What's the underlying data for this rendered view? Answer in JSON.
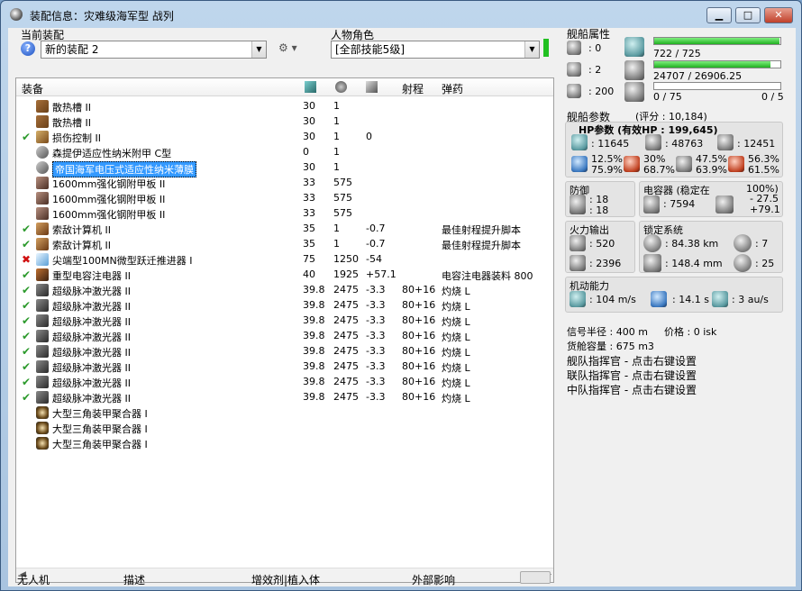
{
  "window": {
    "title": "装配信息：灾难级海军型 战列",
    "btn_minimize": "▁",
    "btn_maximize": "□",
    "btn_close": "✕"
  },
  "fitting": {
    "current_label": "当前装配",
    "current_value": "新的装配 2",
    "character_label": "人物角色",
    "character_value": "[全部技能5级]"
  },
  "columns": {
    "equipment": "装备",
    "range": "射程",
    "ammo": "弹药"
  },
  "rows": [
    {
      "check": "",
      "icon": "heat",
      "name": "散热槽 II",
      "cpu": "30",
      "pg": "1",
      "cap": "",
      "range": "",
      "ammo": ""
    },
    {
      "check": "",
      "icon": "heat",
      "name": "散热槽 II",
      "cpu": "30",
      "pg": "1",
      "cap": "",
      "range": "",
      "ammo": ""
    },
    {
      "check": "✔",
      "icon": "dmg",
      "name": "损伤控制 II",
      "cpu": "30",
      "pg": "1",
      "cap": "0",
      "range": "",
      "ammo": ""
    },
    {
      "check": "",
      "icon": "nano",
      "name": "森提伊适应性纳米附甲 C型",
      "cpu": "0",
      "pg": "1",
      "cap": "",
      "range": "",
      "ammo": ""
    },
    {
      "check": "",
      "icon": "nano",
      "name": "帝国海军电压式适应性纳米薄膜",
      "cpu": "30",
      "pg": "1",
      "cap": "",
      "range": "",
      "ammo": "",
      "selected": true
    },
    {
      "check": "",
      "icon": "plate",
      "name": "1600mm强化钢附甲板 II",
      "cpu": "33",
      "pg": "575",
      "cap": "",
      "range": "",
      "ammo": ""
    },
    {
      "check": "",
      "icon": "plate",
      "name": "1600mm强化钢附甲板 II",
      "cpu": "33",
      "pg": "575",
      "cap": "",
      "range": "",
      "ammo": ""
    },
    {
      "check": "",
      "icon": "plate",
      "name": "1600mm强化钢附甲板 II",
      "cpu": "33",
      "pg": "575",
      "cap": "",
      "range": "",
      "ammo": ""
    },
    {
      "check": "✔",
      "icon": "scan",
      "name": "索敌计算机 II",
      "cpu": "35",
      "pg": "1",
      "cap": "-0.7",
      "range": "",
      "ammo": "最佳射程提升脚本"
    },
    {
      "check": "✔",
      "icon": "scan",
      "name": "索敌计算机 II",
      "cpu": "35",
      "pg": "1",
      "cap": "-0.7",
      "range": "",
      "ammo": "最佳射程提升脚本"
    },
    {
      "check": "✖",
      "icon": "mwd",
      "name": "尖端型100MN微型跃迁推进器 I",
      "cpu": "75",
      "pg": "1250",
      "cap": "-54",
      "range": "",
      "ammo": ""
    },
    {
      "check": "✔",
      "icon": "cap",
      "name": "重型电容注电器 II",
      "cpu": "40",
      "pg": "1925",
      "cap": "+57.1",
      "range": "",
      "ammo": "电容注电器装料 800"
    },
    {
      "check": "✔",
      "icon": "laser",
      "name": "超级脉冲激光器 II",
      "cpu": "39.8",
      "pg": "2475",
      "cap": "-3.3",
      "range": "80+16",
      "ammo": "灼烧 L"
    },
    {
      "check": "✔",
      "icon": "laser",
      "name": "超级脉冲激光器 II",
      "cpu": "39.8",
      "pg": "2475",
      "cap": "-3.3",
      "range": "80+16",
      "ammo": "灼烧 L"
    },
    {
      "check": "✔",
      "icon": "laser",
      "name": "超级脉冲激光器 II",
      "cpu": "39.8",
      "pg": "2475",
      "cap": "-3.3",
      "range": "80+16",
      "ammo": "灼烧 L"
    },
    {
      "check": "✔",
      "icon": "laser",
      "name": "超级脉冲激光器 II",
      "cpu": "39.8",
      "pg": "2475",
      "cap": "-3.3",
      "range": "80+16",
      "ammo": "灼烧 L"
    },
    {
      "check": "✔",
      "icon": "laser",
      "name": "超级脉冲激光器 II",
      "cpu": "39.8",
      "pg": "2475",
      "cap": "-3.3",
      "range": "80+16",
      "ammo": "灼烧 L"
    },
    {
      "check": "✔",
      "icon": "laser",
      "name": "超级脉冲激光器 II",
      "cpu": "39.8",
      "pg": "2475",
      "cap": "-3.3",
      "range": "80+16",
      "ammo": "灼烧 L"
    },
    {
      "check": "✔",
      "icon": "laser",
      "name": "超级脉冲激光器 II",
      "cpu": "39.8",
      "pg": "2475",
      "cap": "-3.3",
      "range": "80+16",
      "ammo": "灼烧 L"
    },
    {
      "check": "✔",
      "icon": "laser",
      "name": "超级脉冲激光器 II",
      "cpu": "39.8",
      "pg": "2475",
      "cap": "-3.3",
      "range": "80+16",
      "ammo": "灼烧 L"
    },
    {
      "check": "",
      "icon": "rig",
      "name": "大型三角装甲聚合器 I",
      "cpu": "",
      "pg": "",
      "cap": "",
      "range": "",
      "ammo": ""
    },
    {
      "check": "",
      "icon": "rig",
      "name": "大型三角装甲聚合器 I",
      "cpu": "",
      "pg": "",
      "cap": "",
      "range": "",
      "ammo": ""
    },
    {
      "check": "",
      "icon": "rig",
      "name": "大型三角装甲聚合器 I",
      "cpu": "",
      "pg": "",
      "cap": "",
      "range": "",
      "ammo": ""
    }
  ],
  "bottom_tabs": [
    "无人机",
    "描述",
    "增效剂|植入体",
    "外部影响"
  ],
  "ship_attr": {
    "title": "舰船属性",
    "turret_slots": ": 0",
    "launcher_slots": ": 2",
    "drone_bay": ": 200",
    "cpu_text": "722 / 725",
    "cpu_fraction": 0.996,
    "pg_text": "24707 / 26906.25",
    "pg_fraction": 0.918,
    "calib_text": "0 / 75",
    "calib_fraction": 0,
    "calib_right": "0 / 5"
  },
  "ship_params": {
    "title": "舰船参数",
    "rating": "(评分 : 10,184)",
    "hp_line": "HP参数 (有效HP : 199,645)",
    "hp_shield": ": 11645",
    "hp_armor": ": 48763",
    "hp_struct": ": 12451",
    "res_em": "12.5%",
    "res_em2": "75.9%",
    "res_th": "30%",
    "res_th2": "68.7%",
    "res_ki": "47.5%",
    "res_ki2": "63.9%",
    "res_ex": "56.3%",
    "res_ex2": "61.5%"
  },
  "defense": {
    "title": "防御",
    "v1": ": 18",
    "v2": ": 18"
  },
  "capacitor": {
    "title": "电容器 (稳定在",
    "pct": "100%)",
    "amount": ": 7594",
    "d1": "- 27.5",
    "d2": "+79.1"
  },
  "firepower": {
    "title": "火力输出",
    "dps": ": 520",
    "volley": ": 2396"
  },
  "targeting": {
    "title": "锁定系统",
    "range": ": 84.38 km",
    "targets": ": 7",
    "scan": ": 148.4 mm",
    "sensor": ": 25"
  },
  "mobility": {
    "title": "机动能力",
    "speed": ": 104 m/s",
    "align": ": 14.1 s",
    "warp": ": 3 au/s"
  },
  "misc": {
    "sig_radius": "信号半径 : 400 m",
    "price": "价格 : 0 isk",
    "cargo": "货舱容量 : 675 m3",
    "fleet1": "舰队指挥官 - 点击右键设置",
    "fleet2": "联队指挥官 - 点击右键设置",
    "fleet3": "中队指挥官 - 点击右键设置"
  }
}
